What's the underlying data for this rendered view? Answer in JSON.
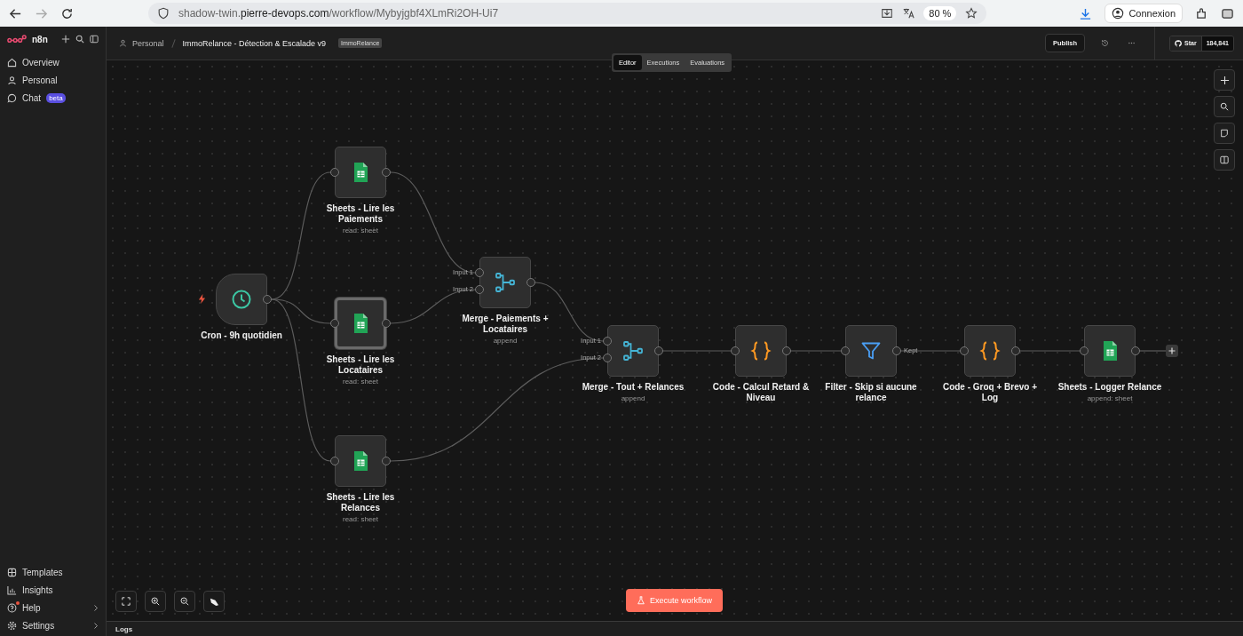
{
  "browser": {
    "url": "shadow-twin.**pierre-devops.com**/workflow/Mybyjgbf4XLmRi2OH-Ui7",
    "zoom": "80 %",
    "profile": "Connexion"
  },
  "sidebar": {
    "logo": "n8n",
    "items": [
      {
        "label": "Overview"
      },
      {
        "label": "Personal"
      },
      {
        "label": "Chat",
        "badge": "beta"
      }
    ],
    "bottom_items": [
      {
        "label": "Templates",
        "chevron": false,
        "notification": false
      },
      {
        "label": "Insights",
        "chevron": false,
        "notification": false
      },
      {
        "label": "Help",
        "chevron": true,
        "notification": true
      },
      {
        "label": "Settings",
        "chevron": true,
        "notification": false
      }
    ]
  },
  "header": {
    "breadcrumb": "Personal",
    "workflow_name": "ImmoRelance - Détection & Escalade v9",
    "tag": "ImmoRelance",
    "publish": "Publish",
    "star": "Star",
    "star_count": "184,841"
  },
  "tabs": [
    {
      "label": "Editor",
      "selected": true
    },
    {
      "label": "Executions",
      "selected": false
    },
    {
      "label": "Evaluations",
      "selected": false
    }
  ],
  "nodes": [
    {
      "kind": "trigger",
      "title": "Cron - 9h quotidien",
      "selected": false
    },
    {
      "kind": "sheets",
      "title": "Sheets - Lire les Paiements",
      "subtitle": "read: sheet",
      "selected": false
    },
    {
      "kind": "sheets",
      "title": "Sheets - Lire les Locataires",
      "subtitle": "read: sheet",
      "selected": true
    },
    {
      "kind": "sheets",
      "title": "Sheets - Lire les Relances",
      "subtitle": "read: sheet",
      "selected": false
    },
    {
      "kind": "merge",
      "title": "Merge - Paiements + Locataires",
      "subtitle": "append",
      "selected": false,
      "inputs": [
        "Input 1",
        "Input 2"
      ]
    },
    {
      "kind": "merge",
      "title": "Merge - Tout + Relances",
      "subtitle": "append",
      "selected": false,
      "inputs": [
        "Input 1",
        "Input 2"
      ]
    },
    {
      "kind": "code",
      "title": "Code - Calcul Retard & Niveau",
      "selected": false
    },
    {
      "kind": "filter",
      "title": "Filter - Skip si aucune relance",
      "selected": false,
      "output_label": "Kept"
    },
    {
      "kind": "code",
      "title": "Code - Groq + Brevo + Log",
      "selected": false
    },
    {
      "kind": "sheets",
      "title": "Sheets - Logger Relance",
      "subtitle": "append: sheet",
      "selected": false
    }
  ],
  "execute_button": "Execute workflow",
  "logs": "Logs"
}
